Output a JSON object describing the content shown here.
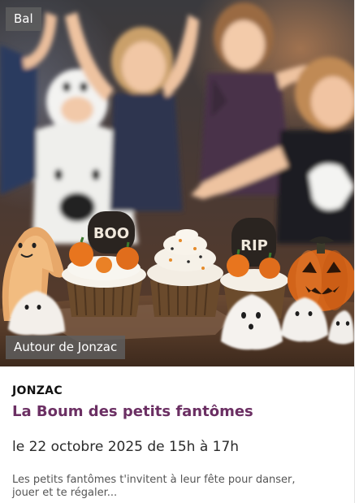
{
  "card": {
    "category_badge": "Bal",
    "location_badge": "Autour de Jonzac",
    "city": "JONZAC",
    "title": "La Boum des petits fantômes",
    "date": "le 22 octobre 2025 de 15h à 17h",
    "description": "Les petits fantômes t'invitent à leur fête pour danser, jouer et te régaler...",
    "image": {
      "cupcake_left_sign": "BOO",
      "cupcake_right_sign": "RIP"
    }
  },
  "colors": {
    "title": "#6b2f63",
    "badge_bg": "#5f5f5f"
  }
}
